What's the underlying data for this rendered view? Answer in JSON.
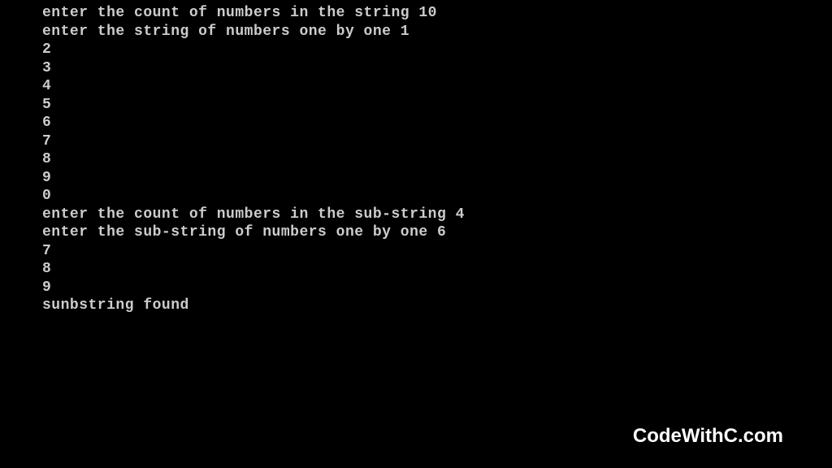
{
  "terminal": {
    "lines": [
      "enter the count of numbers in the string 10",
      "enter the string of numbers one by one 1",
      "2",
      "3",
      "4",
      "5",
      "6",
      "7",
      "8",
      "9",
      "0",
      "enter the count of numbers in the sub-string 4",
      "enter the sub-string of numbers one by one 6",
      "7",
      "8",
      "9",
      "sunbstring found"
    ]
  },
  "watermark": "CodeWithC.com"
}
